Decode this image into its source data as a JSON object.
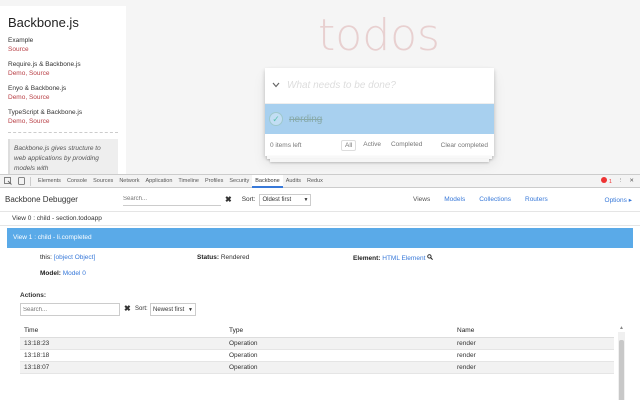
{
  "sidebar": {
    "title": "Backbone.js",
    "frameworks": [
      {
        "name": "Example",
        "links": "Source"
      },
      {
        "name": "Require.js & Backbone.js",
        "links": "Demo, Source"
      },
      {
        "name": "Enyo & Backbone.js",
        "links": "Demo, Source"
      },
      {
        "name": "TypeScript & Backbone.js",
        "links": "Demo, Source"
      }
    ],
    "quote": "Backbone.js gives structure to web applications by providing models with"
  },
  "todo_app": {
    "heading": "todos",
    "new_todo_placeholder": "What needs to be done?",
    "toggle_all_icon": "chevron-down-icon",
    "item": {
      "title": "nerding",
      "completed": true
    },
    "footer": {
      "items_left": "0 items left",
      "filters": [
        "All",
        "Active",
        "Completed"
      ],
      "active_filter": "All",
      "clear_completed": "Clear completed"
    }
  },
  "devtools": {
    "tabs": [
      "Elements",
      "Console",
      "Sources",
      "Network",
      "Application",
      "Timeline",
      "Profiles",
      "Security",
      "Backbone",
      "Audits",
      "Redux"
    ],
    "active_tab": "Backbone",
    "error_count": "1"
  },
  "backbone_debugger": {
    "title": "Backbone Debugger",
    "search_placeholder": "Search...",
    "sort_label": "Sort:",
    "sort_value": "Oldest first",
    "tabs": [
      "Views",
      "Models",
      "Collections",
      "Routers"
    ],
    "active_tab": "Views",
    "options_label": "Options ▸",
    "views": [
      {
        "label": "View 0 : child - section.todoapp",
        "selected": false
      },
      {
        "label": "View 1 : child - li.completed",
        "selected": true
      }
    ],
    "detail": {
      "this_label": "this:",
      "this_value": "[object Object]",
      "status_label": "Status:",
      "status_value": "Rendered",
      "element_label": "Element:",
      "element_value": "HTML Element",
      "model_label": "Model:",
      "model_value": "Model 0",
      "actions_label": "Actions:",
      "actions_search_placeholder": "Search...",
      "actions_sort_label": "Sort:",
      "actions_sort_value": "Newest first",
      "table": {
        "columns": [
          "Time",
          "Type",
          "Name"
        ],
        "rows": [
          {
            "time": "13:18:23",
            "type": "Operation",
            "name": "render"
          },
          {
            "time": "13:18:18",
            "type": "Operation",
            "name": "render"
          },
          {
            "time": "13:18:07",
            "type": "Operation",
            "name": "render"
          }
        ]
      }
    }
  },
  "colors": {
    "accent": "#3879d9",
    "selected_row": "#5aaae8",
    "todo_selected": "#a8d0ef",
    "brand_red": "#b83f45"
  }
}
